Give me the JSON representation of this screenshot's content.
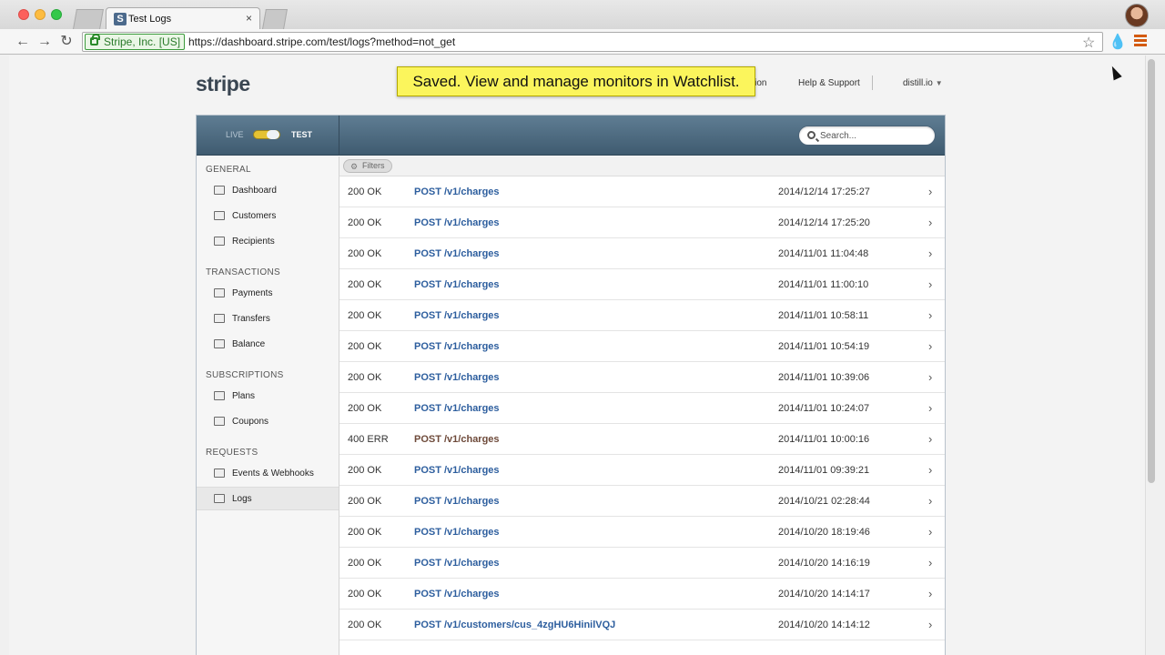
{
  "browser": {
    "tab_title": "Test Logs",
    "tab_favicon": "S",
    "tab_close": "×",
    "ev_cert": "Stripe, Inc. [US]",
    "url": "https://dashboard.stripe.com/test/logs?method=not_get"
  },
  "page": {
    "logo": "stripe",
    "toast": "Saved. View and manage monitors in Watchlist.",
    "nav": {
      "documentation_partial": "tation",
      "help": "Help & Support",
      "account": "distill.io"
    }
  },
  "app": {
    "mode": {
      "live": "LIVE",
      "test": "TEST"
    },
    "search_placeholder": "Search..."
  },
  "sidebar": {
    "sections": [
      {
        "title": "GENERAL",
        "items": [
          "Dashboard",
          "Customers",
          "Recipients"
        ]
      },
      {
        "title": "TRANSACTIONS",
        "items": [
          "Payments",
          "Transfers",
          "Balance"
        ]
      },
      {
        "title": "SUBSCRIPTIONS",
        "items": [
          "Plans",
          "Coupons"
        ]
      },
      {
        "title": "REQUESTS",
        "items": [
          "Events & Webhooks",
          "Logs"
        ]
      }
    ],
    "active_item": "Logs"
  },
  "logs": {
    "filters_label": "Filters",
    "rows": [
      {
        "status": "200 OK",
        "path": "POST /v1/charges",
        "time": "2014/12/14 17:25:27"
      },
      {
        "status": "200 OK",
        "path": "POST /v1/charges",
        "time": "2014/12/14 17:25:20"
      },
      {
        "status": "200 OK",
        "path": "POST /v1/charges",
        "time": "2014/11/01 11:04:48"
      },
      {
        "status": "200 OK",
        "path": "POST /v1/charges",
        "time": "2014/11/01 11:00:10"
      },
      {
        "status": "200 OK",
        "path": "POST /v1/charges",
        "time": "2014/11/01 10:58:11"
      },
      {
        "status": "200 OK",
        "path": "POST /v1/charges",
        "time": "2014/11/01 10:54:19"
      },
      {
        "status": "200 OK",
        "path": "POST /v1/charges",
        "time": "2014/11/01 10:39:06"
      },
      {
        "status": "200 OK",
        "path": "POST /v1/charges",
        "time": "2014/11/01 10:24:07"
      },
      {
        "status": "400 ERR",
        "path": "POST /v1/charges",
        "time": "2014/11/01 10:00:16"
      },
      {
        "status": "200 OK",
        "path": "POST /v1/charges",
        "time": "2014/11/01 09:39:21"
      },
      {
        "status": "200 OK",
        "path": "POST /v1/charges",
        "time": "2014/10/21 02:28:44"
      },
      {
        "status": "200 OK",
        "path": "POST /v1/charges",
        "time": "2014/10/20 18:19:46"
      },
      {
        "status": "200 OK",
        "path": "POST /v1/charges",
        "time": "2014/10/20 14:16:19"
      },
      {
        "status": "200 OK",
        "path": "POST /v1/charges",
        "time": "2014/10/20 14:14:17"
      },
      {
        "status": "200 OK",
        "path": "POST /v1/customers/cus_4zgHU6HinilVQJ",
        "time": "2014/10/20 14:14:12"
      }
    ]
  },
  "colors": {
    "header_top": "#5f7d93",
    "header_bottom": "#3f5b70",
    "link_blue": "#2d5e9e",
    "toast_yellow": "#fbf55c",
    "toggle_yellow": "#e4c233"
  },
  "icons": {
    "back": "back-arrow-icon",
    "forward": "forward-arrow-icon",
    "reload": "reload-icon",
    "star": "bookmark-star-icon",
    "extension": "distill-drop-icon",
    "menu": "hamburger-menu-icon",
    "search": "search-icon",
    "filters": "gear-icon",
    "row": "chevron-right-icon"
  }
}
